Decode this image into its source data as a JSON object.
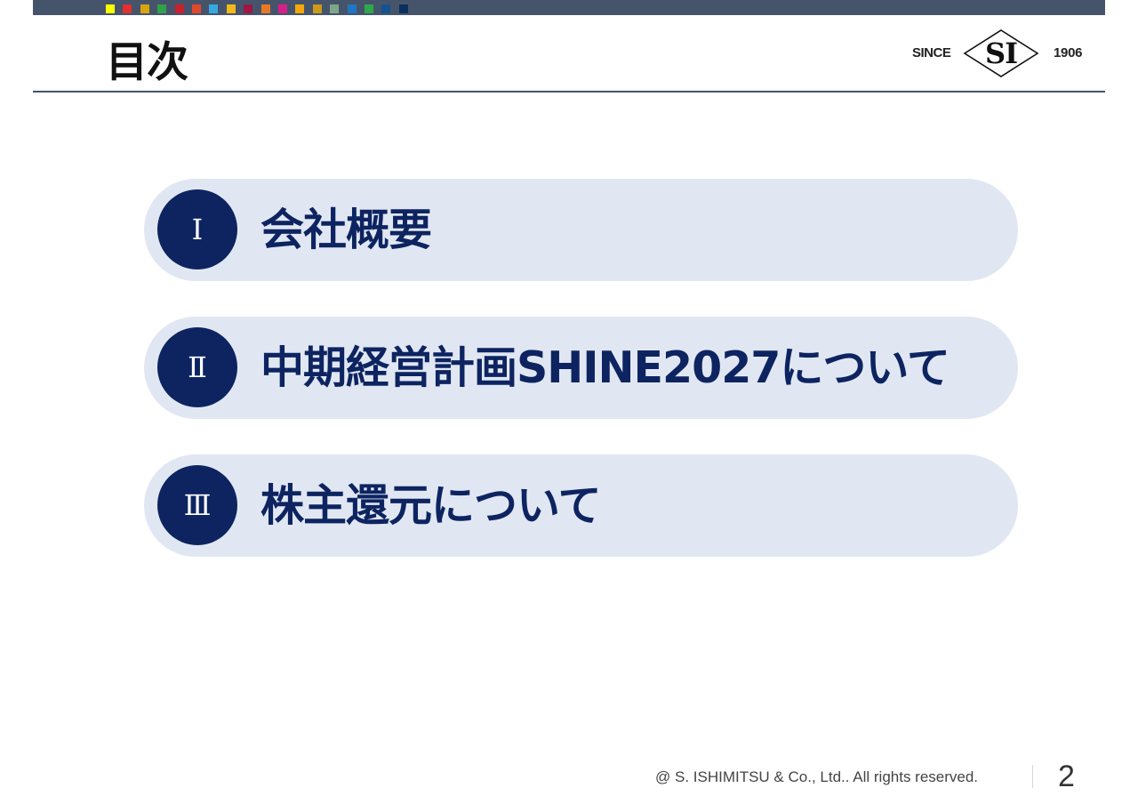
{
  "header": {
    "title": "目次",
    "accent_color": "#46546b",
    "swatches": [
      "#ffff00",
      "#e32f2f",
      "#d9a40f",
      "#2fa24a",
      "#c8202e",
      "#e0472b",
      "#36a9e1",
      "#f7b819",
      "#9d1742",
      "#e97824",
      "#d81e89",
      "#f5a80a",
      "#cc9a18",
      "#7ea689",
      "#1f77c3",
      "#2fa84a",
      "#14538f",
      "#0d2f5e"
    ]
  },
  "logo": {
    "since": "SINCE",
    "initials": "SI",
    "year": "1906"
  },
  "toc": {
    "items": [
      {
        "number": "Ⅰ",
        "label": "会社概要"
      },
      {
        "number": "Ⅱ",
        "label": "中期経営計画SHINE2027について"
      },
      {
        "number": "Ⅲ",
        "label": "株主還元について"
      }
    ],
    "item_bg": "#e1e7f2",
    "circle_color": "#0d2461"
  },
  "footer": {
    "copyright": "@ S. ISHIMITSU & Co., Ltd.. All rights reserved.",
    "page_number": "2"
  }
}
